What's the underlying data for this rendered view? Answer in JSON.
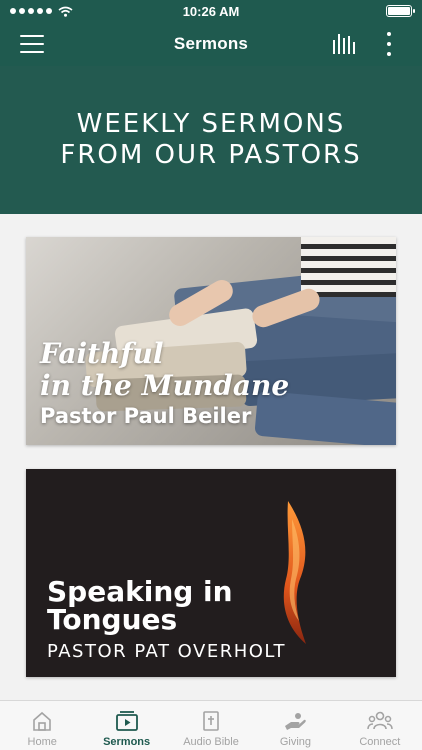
{
  "status_bar": {
    "time": "10:26 AM"
  },
  "nav": {
    "title": "Sermons"
  },
  "hero": {
    "line1": "WEEKLY SERMONS",
    "line2": "FROM OUR PASTORS"
  },
  "sermons": [
    {
      "title_line1": "Faithful",
      "title_line2": "in the Mundane",
      "pastor": "Pastor Paul Beiler"
    },
    {
      "title_line1": "Speaking in",
      "title_line2": "Tongues",
      "pastor": "PASTOR PAT OVERHOLT"
    }
  ],
  "tabs": [
    {
      "label": "Home",
      "icon": "home-icon"
    },
    {
      "label": "Sermons",
      "icon": "play-icon"
    },
    {
      "label": "Audio Bible",
      "icon": "bible-icon"
    },
    {
      "label": "Giving",
      "icon": "giving-hand-icon"
    },
    {
      "label": "Connect",
      "icon": "people-icon"
    }
  ],
  "colors": {
    "primary": "#1f5a4f",
    "tab_inactive": "#a3a3a3"
  }
}
